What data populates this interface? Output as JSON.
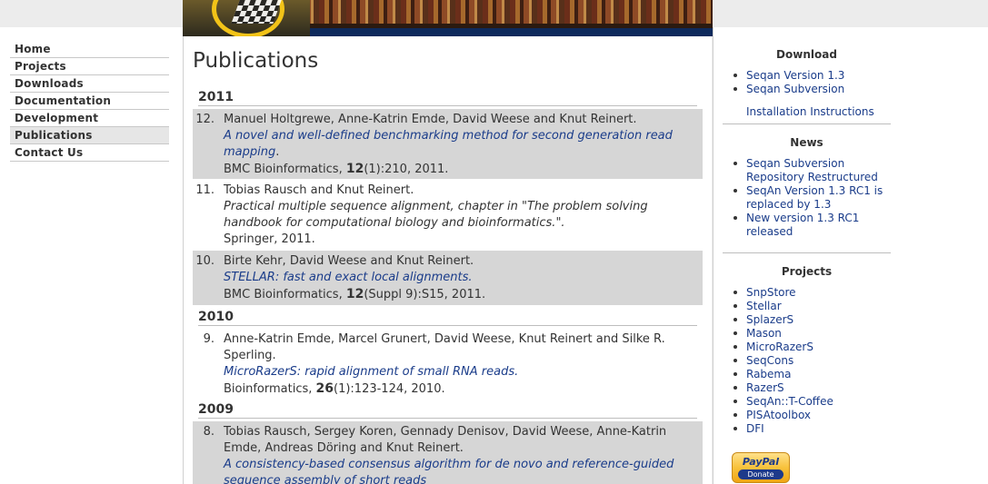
{
  "nav": {
    "items": [
      {
        "label": "Home"
      },
      {
        "label": "Projects"
      },
      {
        "label": "Downloads"
      },
      {
        "label": "Documentation"
      },
      {
        "label": "Development"
      },
      {
        "label": "Publications",
        "active": true
      },
      {
        "label": "Contact Us"
      }
    ]
  },
  "main": {
    "title": "Publications",
    "years": [
      "2011",
      "2010",
      "2009"
    ],
    "pubs": [
      {
        "num": "12.",
        "authors": "Manuel Holtgrewe, Anne-Katrin Emde, David Weese and Knut Reinert.",
        "title1": "A novel and well-defined benchmarking method for second generation read",
        "title2": "mapping",
        "title_suffix": ".",
        "journal": "BMC Bioinformatics, ",
        "vol": "12",
        "rest": "(1):210, 2011."
      },
      {
        "num": "11.",
        "authors": "Tobias Rausch and Knut Reinert.",
        "title1": "Practical multiple sequence alignment, chapter in \"The problem solving",
        "title2": "handbook for computational biology and bioinformatics.\".",
        "pub": "Springer, 2011."
      },
      {
        "num": "10.",
        "authors": "Birte Kehr, David Weese and Knut Reinert.",
        "title1": "STELLAR: fast and exact local alignments",
        "title_suffix": ".",
        "journal": "BMC Bioinformatics, ",
        "vol": "12",
        "rest": "(Suppl 9):S15, 2011."
      },
      {
        "num": "9.",
        "authors1": "Anne-Katrin Emde, Marcel Grunert, David Weese, Knut Reinert and Silke R.",
        "authors2": "Sperling.",
        "title1": "MicroRazerS: rapid alignment of small RNA reads",
        "title_suffix": ".",
        "journal": "Bioinformatics, ",
        "vol": "26",
        "rest": "(1):123-124, 2010."
      },
      {
        "num": "8.",
        "authors1": "Tobias Rausch, Sergey Koren, Gennady Denisov, David Weese, Anne-Katrin",
        "authors2": "Emde, Andreas Döring and Knut Reinert.",
        "title1": "A consistency-based consensus algorithm for de novo and reference-guided",
        "title2": "sequence assembly of short reads"
      }
    ]
  },
  "sidebar": {
    "download": {
      "heading": "Download",
      "items": [
        "Seqan Version 1.3",
        "Seqan Subversion"
      ],
      "extra": "Installation Instructions"
    },
    "news": {
      "heading": "News",
      "items": [
        {
          "l1": "Seqan Subversion",
          "l2": "Repository Restructured"
        },
        {
          "l1": "SeqAn Version 1.3 RC1 is",
          "l2": "replaced by 1.3"
        },
        {
          "l1": "New version 1.3 RC1",
          "l2": "released"
        }
      ]
    },
    "projects": {
      "heading": "Projects",
      "items": [
        "SnpStore",
        "Stellar",
        "SplazerS",
        "Mason",
        "MicroRazerS",
        "SeqCons",
        "Rabema",
        "RazerS",
        "SeqAn::T-Coffee",
        "PISAtoolbox",
        "DFI"
      ]
    },
    "paypal": {
      "brand": "PayPal",
      "action": "Donate"
    }
  }
}
